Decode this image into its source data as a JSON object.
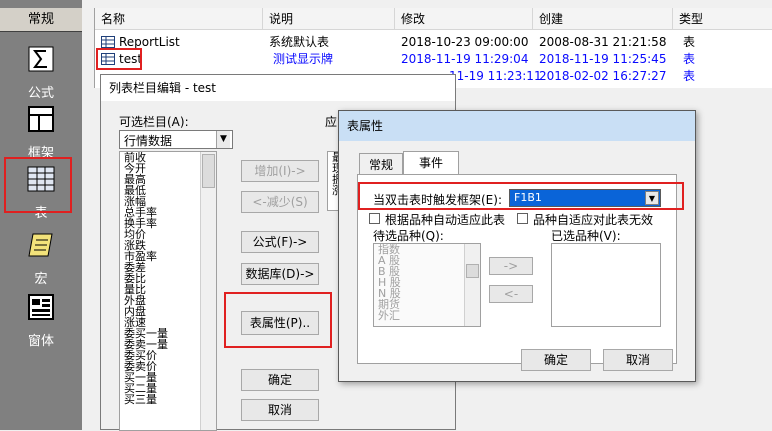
{
  "sidebar": {
    "header": "常规",
    "items": [
      {
        "label": "公式",
        "icon": "formula-icon"
      },
      {
        "label": "框架",
        "icon": "frame-icon"
      },
      {
        "label": "表",
        "icon": "table-icon"
      },
      {
        "label": "宏",
        "icon": "macro-scroll-icon"
      },
      {
        "label": "窗体",
        "icon": "form-window-icon"
      }
    ]
  },
  "list": {
    "columns": [
      "名称",
      "说明",
      "修改",
      "创建",
      "类型"
    ],
    "rows": [
      {
        "name": "ReportList",
        "desc": "系统默认表",
        "modified": "2018-10-23 09:00:00",
        "created": "2008-08-31 21:21:58",
        "type": "表"
      },
      {
        "name": "test",
        "desc": "测试显示牌",
        "modified": "2018-11-19 11:29:04",
        "created": "2018-11-19 11:25:45",
        "type": "表"
      },
      {
        "name": "",
        "desc": "",
        "modified": "11-19 11:23:11",
        "created": "2018-02-02 16:27:27",
        "type": "表"
      }
    ]
  },
  "column_editor": {
    "title": "列表栏目编辑 - test",
    "available_label": "可选栏目(A):",
    "selected_label_fragment": "应",
    "dropdown_value": "行情数据",
    "available_items": [
      "前收",
      "今开",
      "最高",
      "最低",
      "涨幅",
      "总手率",
      "换手率",
      "均价",
      "涨跌",
      "市盈率",
      "委差",
      "委比",
      "量比",
      "外盘",
      "内盘",
      "涨速",
      "委买一量",
      "委卖一量",
      "委买价",
      "委卖价",
      "买一量",
      "买二量",
      "买三量"
    ],
    "selected_items_fragment": [
      "最",
      "现",
      "振",
      "涨"
    ],
    "buttons": {
      "add": "增加(I)->",
      "remove": "<-减少(S)",
      "formula": "公式(F)->",
      "database": "数据库(D)->",
      "table_props": "表属性(P)..",
      "ok": "确定",
      "cancel": "取消"
    }
  },
  "table_props": {
    "title": "表属性",
    "tabs": [
      "常规",
      "事件"
    ],
    "trigger_label": "当双击表时触发框架(E):",
    "trigger_value": "F1B1",
    "check1": "根据品种自动适应此表",
    "check2": "品种自适应对此表无效",
    "pending_label": "待选品种(Q):",
    "selected_label": "已选品种(V):",
    "pending_items": [
      "指数",
      "A 股",
      "B 股",
      "H 股",
      "N 股",
      "期货",
      "外汇"
    ],
    "move_right": "->",
    "move_left": "<-",
    "ok": "确定",
    "cancel": "取消"
  },
  "colors": {
    "highlight": "#e02020",
    "selected": "#0a0aff",
    "title_active": "#c9dff5"
  }
}
